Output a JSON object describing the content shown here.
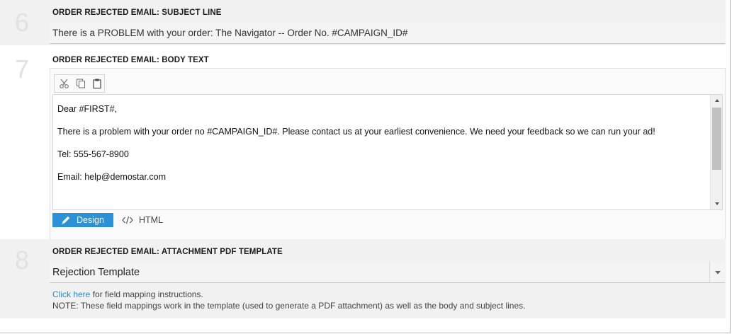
{
  "sections": {
    "s6": {
      "number": "6",
      "label": "ORDER REJECTED EMAIL: SUBJECT LINE",
      "value": "There is a PROBLEM with your order: The Navigator -- Order No. #CAMPAIGN_ID#"
    },
    "s7": {
      "number": "7",
      "label": "ORDER REJECTED EMAIL: BODY TEXT",
      "toolbar": {
        "icons": [
          "cut-icon",
          "copy-icon",
          "paste-icon"
        ]
      },
      "body": [
        "Dear #FIRST#,",
        "There is a problem with your order no #CAMPAIGN_ID#.  Please contact us at your earliest convenience. We need your feedback so we can run your ad!",
        "Tel: 555-567-8900",
        "Email: help@demostar.com"
      ],
      "mode_design": "Design",
      "mode_html": "HTML"
    },
    "s8": {
      "number": "8",
      "label": "ORDER REJECTED EMAIL: ATTACHMENT PDF TEMPLATE",
      "selected": "Rejection Template",
      "link_text": "Click here",
      "link_suffix": " for field mapping instructions.",
      "note": "NOTE: These field mappings work in the template (used to generate a PDF attachment) as well as the body and subject lines."
    }
  },
  "colors": {
    "accent": "#2b92d8",
    "link": "#2b88c8",
    "section_bg": "#f1f1f1",
    "step_number": "#e1e1e1"
  }
}
